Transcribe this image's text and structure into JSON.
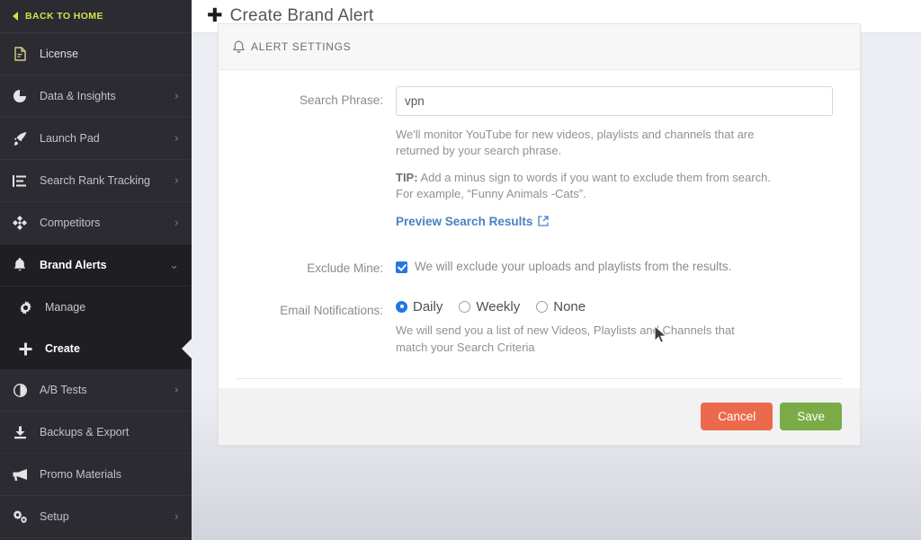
{
  "sidebar": {
    "back_home": {
      "label": "BACK TO HOME",
      "icon": "caret-left-icon",
      "color": "#d8e04a"
    },
    "items": [
      {
        "label": "License",
        "icon": "file-license-icon",
        "chevron": ""
      },
      {
        "label": "Data & Insights",
        "icon": "pie-chart-icon",
        "chevron": "›"
      },
      {
        "label": "Launch Pad",
        "icon": "rocket-icon",
        "chevron": "›"
      },
      {
        "label": "Search Rank Tracking",
        "icon": "list-icon",
        "chevron": "›"
      },
      {
        "label": "Competitors",
        "icon": "compass-icon",
        "chevron": "›"
      },
      {
        "label": "Brand Alerts",
        "icon": "bell-icon",
        "chevron": "⌄"
      },
      {
        "label": "Manage",
        "icon": "gear-icon",
        "chevron": ""
      },
      {
        "label": "Create",
        "icon": "plus-icon",
        "chevron": ""
      },
      {
        "label": "A/B Tests",
        "icon": "contrast-circle-icon",
        "chevron": "›"
      },
      {
        "label": "Backups & Export",
        "icon": "download-icon",
        "chevron": ""
      },
      {
        "label": "Promo Materials",
        "icon": "megaphone-icon",
        "chevron": ""
      },
      {
        "label": "Setup",
        "icon": "gears-icon",
        "chevron": "›"
      }
    ]
  },
  "topbar": {
    "plus_icon": "plus-icon",
    "title": "Create Brand Alert"
  },
  "card": {
    "header": {
      "icon": "bell-icon",
      "title": "ALERT SETTINGS"
    },
    "search_phrase": {
      "label": "Search Phrase:",
      "value": "vpn",
      "placeholder": "",
      "help_1": "We'll monitor YouTube for new videos, playlists and channels that are returned by your search phrase.",
      "tip_prefix": "TIP:",
      "tip_text": " Add a minus sign to words if you want to exclude them from search. For example, “Funny Animals -Cats”.",
      "preview_link": "Preview Search Results",
      "preview_link_icon": "external-link-icon"
    },
    "exclude_mine": {
      "label": "Exclude Mine:",
      "checked": true,
      "text": "We will exclude your uploads and playlists from the results."
    },
    "email_notifications": {
      "label": "Email Notifications:",
      "options": [
        {
          "label": "Daily",
          "selected": true
        },
        {
          "label": "Weekly",
          "selected": false
        },
        {
          "label": "None",
          "selected": false
        }
      ],
      "help": "We will send you a list of new Videos, Playlists and Channels that match your Search Criteria"
    },
    "footer": {
      "cancel_label": "Cancel",
      "save_label": "Save"
    }
  },
  "colors": {
    "accent_yellow": "#d8e04a",
    "sidebar_bg": "#2b2b31",
    "sidebar_group_bg": "#1e1e23",
    "checkbox_blue": "#2476e0",
    "link_blue": "#4a80c4",
    "cancel_red": "#ec6a4c",
    "save_green": "#7aab46",
    "page_bg": "#eceef3"
  }
}
